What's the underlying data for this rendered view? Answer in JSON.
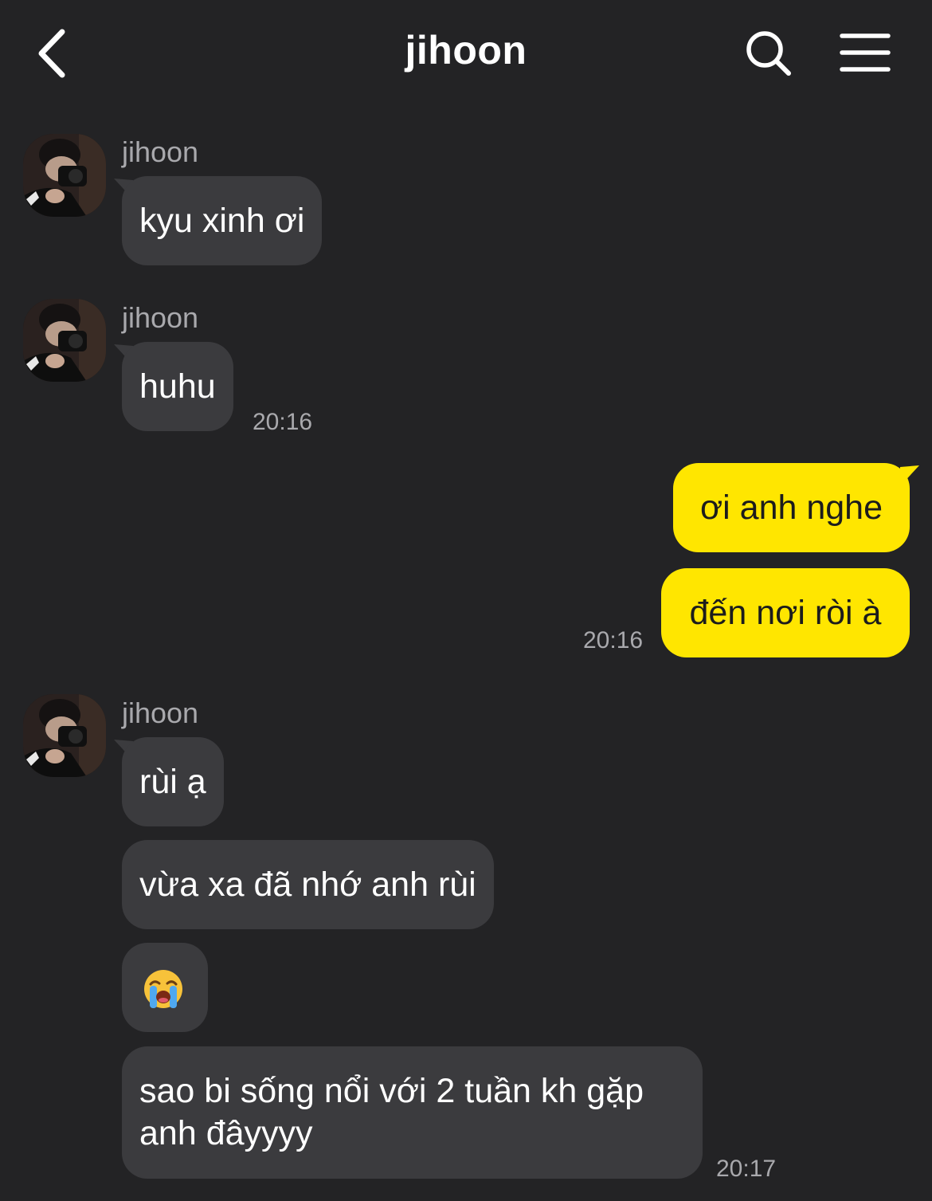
{
  "header": {
    "title": "jihoon",
    "back_icon": "chevron-left-icon",
    "search_icon": "search-icon",
    "menu_icon": "hamburger-menu-icon"
  },
  "colors": {
    "background": "#232325",
    "incoming_bubble": "#3b3b3e",
    "outgoing_bubble": "#ffe600",
    "secondary_text": "#a9a9ad"
  },
  "messages": {
    "group1": {
      "sender": "jihoon",
      "texts": [
        "kyu xinh ơi"
      ]
    },
    "group2": {
      "sender": "jihoon",
      "texts": [
        "huhu"
      ],
      "time": "20:16"
    },
    "outgoing": {
      "texts": [
        "ơi anh nghe",
        "đến nơi ròi à"
      ],
      "time": "20:16"
    },
    "group3": {
      "sender": "jihoon",
      "texts": [
        "rùi ạ",
        "vừa xa đã nhớ anh rùi",
        "😭",
        "sao bi sống nổi với 2 tuần kh gặp anh đâyyyy"
      ],
      "emoji_icon": "loudly-crying-face-emoji",
      "time": "20:17"
    }
  }
}
